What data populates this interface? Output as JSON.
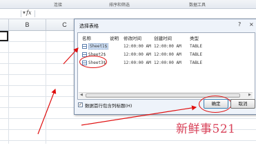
{
  "ribbon": {
    "groups": [
      "连接",
      "排序和筛选",
      "数据工具"
    ]
  },
  "formula_bar": {
    "fx": "fx",
    "value": ""
  },
  "columns": [
    "B",
    "C"
  ],
  "dialog": {
    "title": "选择表格",
    "help": "?",
    "close": "×",
    "headers": [
      "名称",
      "说明",
      "修改时间",
      "创建时间",
      "类型"
    ],
    "rows": [
      {
        "name": "Sheet1$",
        "description": "",
        "modified": "12:00:00 AM",
        "created": "12:00:00 AM",
        "type": "TABLE",
        "selected": true
      },
      {
        "name": "Sheet2$",
        "description": "",
        "modified": "12:00:00 AM",
        "created": "12:00:00 AM",
        "type": "TABLE",
        "selected": false
      },
      {
        "name": "Sheet3$",
        "description": "",
        "modified": "12:00:00 AM",
        "created": "12:00:00 AM",
        "type": "TABLE",
        "selected": false
      }
    ],
    "first_row_has_headers": {
      "label": "数据首行包含列标题(H)",
      "checked": true
    },
    "ok_label": "确定",
    "cancel_label": "取消"
  },
  "watermark": "新鲜事521",
  "colors": {
    "annotation_red": "#e01010",
    "watermark": "#d9435a"
  }
}
